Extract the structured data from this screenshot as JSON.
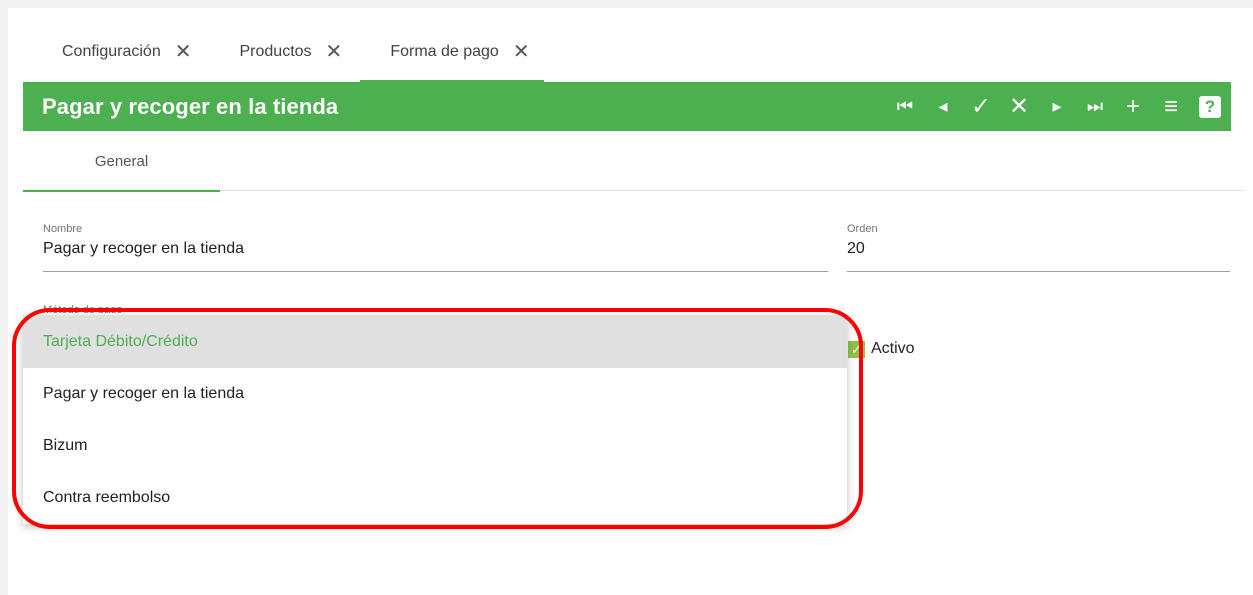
{
  "tabs": [
    {
      "label": "Configuración",
      "close": "✕"
    },
    {
      "label": "Productos",
      "close": "✕"
    },
    {
      "label": "Forma de pago",
      "close": "✕"
    }
  ],
  "header": {
    "title": "Pagar y recoger en la tienda",
    "toolbar": {
      "first": "⏮",
      "prev": "◂",
      "save": "✓",
      "cancel": "✕",
      "next": "▸",
      "last": "⏭",
      "add": "+",
      "list": "≡",
      "help": "?"
    },
    "accent_color": "#4caf50"
  },
  "subtabs": [
    {
      "label": "General"
    }
  ],
  "form": {
    "nombre": {
      "label": "Nombre",
      "value": "Pagar y recoger en la tienda"
    },
    "orden": {
      "label": "Orden",
      "value": "20"
    },
    "metodo": {
      "label": "Método de pago"
    },
    "activo": {
      "label": "Activo",
      "checked": true
    }
  },
  "dropdown": {
    "options": [
      "Tarjeta Débito/Crédito",
      "Pagar y recoger en la tienda",
      "Bizum",
      "Contra reembolso"
    ],
    "selected_index": 0
  }
}
